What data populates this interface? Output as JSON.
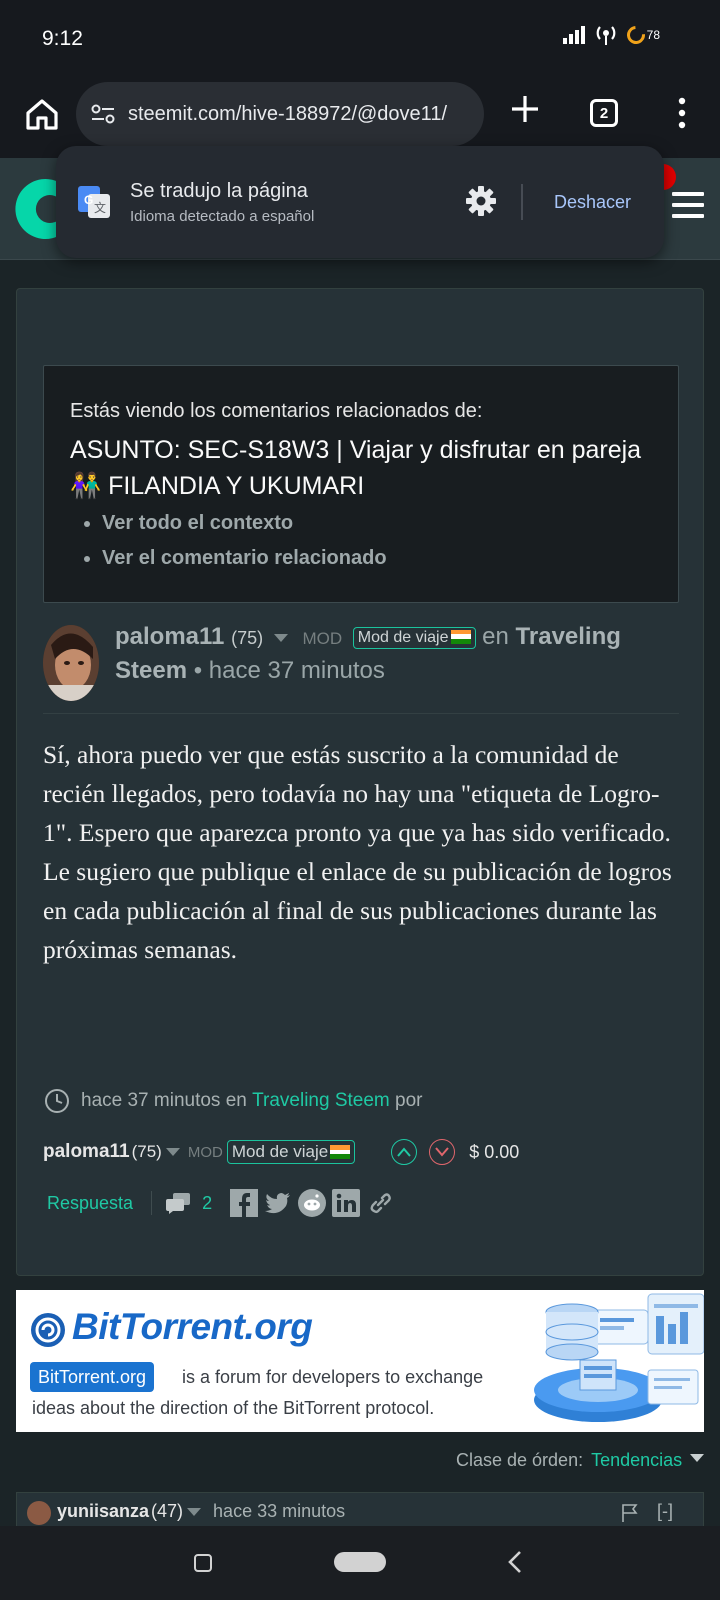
{
  "status_bar": {
    "time": "9:12",
    "battery": "78"
  },
  "browser": {
    "url": "steemit.com/hive-188972/@dove11/",
    "tab_count": "2"
  },
  "translate_popup": {
    "title": "Se tradujo la página",
    "subtitle": "Idioma detectado a español",
    "undo_label": "Deshacer"
  },
  "context_box": {
    "label": "Estás viendo los comentarios relacionados de:",
    "title": "ASUNTO: SEC-S18W3 | Viajar y disfrutar en pareja 👫 FILANDIA Y UKUMARI",
    "links": [
      "Ver todo el contexto",
      "Ver el comentario relacionado"
    ]
  },
  "comment": {
    "author": "paloma11",
    "reputation": "(75)",
    "mod_label": "MOD",
    "badge": "Mod de viaje",
    "in_word": "en",
    "community": "Traveling Steem",
    "time_ago": "• hace 37 minutos",
    "body": "Sí, ahora puedo ver que estás suscrito a la comunidad de recién llegados, pero todavía no hay una \"etiqueta de Logro-1\". Espero que aparezca pronto ya que ya has sido verificado. Le sugiero que publique el enlace de su publicación de logros en cada publicación al final de sus publicaciones durante las próximas semanas.",
    "meta_prefix": "hace 37 minutos en",
    "meta_community": "Traveling Steem",
    "meta_suffix": "por",
    "payout": "$ 0.00",
    "reply_label": "Respuesta",
    "comment_count": "2"
  },
  "ad": {
    "title": "BitTorrent.org",
    "pill": "BitTorrent.org",
    "line1": "is a forum for developers to exchange",
    "line2": "ideas about the direction of the BitTorrent protocol."
  },
  "sort": {
    "label": "Clase de órden:",
    "value": "Tendencias"
  },
  "next_comment": {
    "author": "yuniisanza",
    "reputation": "(47)",
    "time_ago": "hace 33 minutos",
    "collapse": "[-]"
  },
  "colors": {
    "accent": "#1fc9a4",
    "background": "#1b2427",
    "card": "#263237"
  }
}
